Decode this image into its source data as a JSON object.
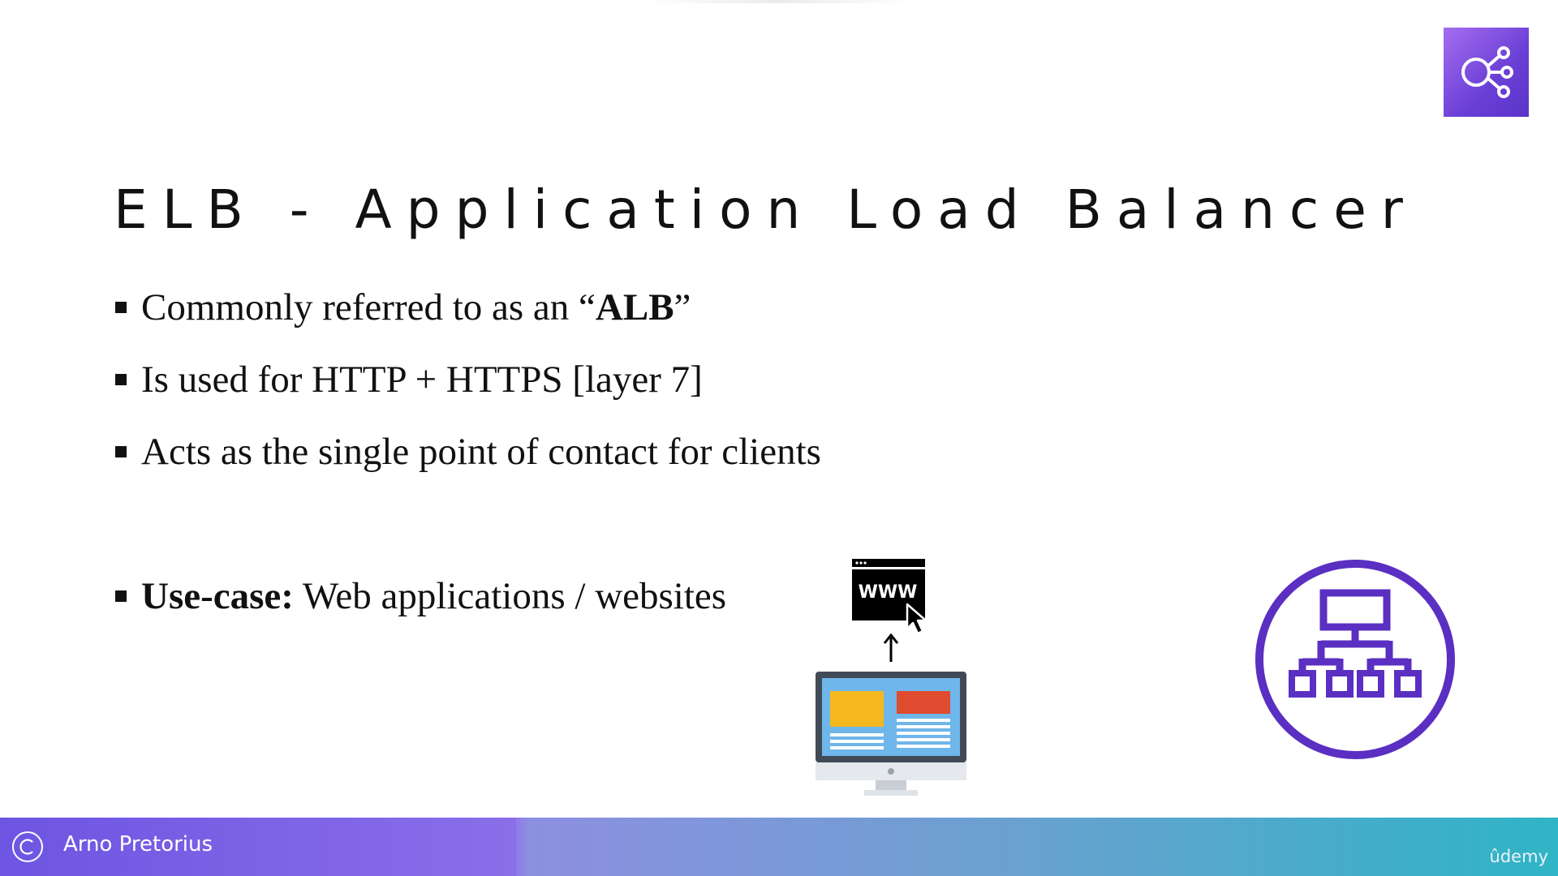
{
  "slide": {
    "title": "ELB - Application Load Balancer",
    "bullets": [
      {
        "pre": "Commonly referred to as an “",
        "bold": "ALB",
        "post": "”"
      },
      {
        "pre": "Is used for HTTP + HTTPS [layer 7]",
        "bold": "",
        "post": ""
      },
      {
        "pre": "Acts as the single point of contact for clients",
        "bold": "",
        "post": ""
      },
      {
        "pre": "",
        "bold": "Use-case:",
        "post": " Web applications / websites"
      }
    ],
    "www_label": "WWW"
  },
  "footer": {
    "author": "Arno Pretorius",
    "brand": "ûdemy"
  },
  "icons": {
    "badge": "elastic-load-balancing-icon",
    "alb": "application-load-balancer-icon",
    "web": "www-browser-icon",
    "client": "desktop-monitor-icon",
    "copyright": "copyright-icon"
  },
  "colors": {
    "badge": "#7b4fe0",
    "alb_icon": "#5a2fc2",
    "footer_start": "#6d55e2",
    "footer_end": "#2fb4c6"
  }
}
